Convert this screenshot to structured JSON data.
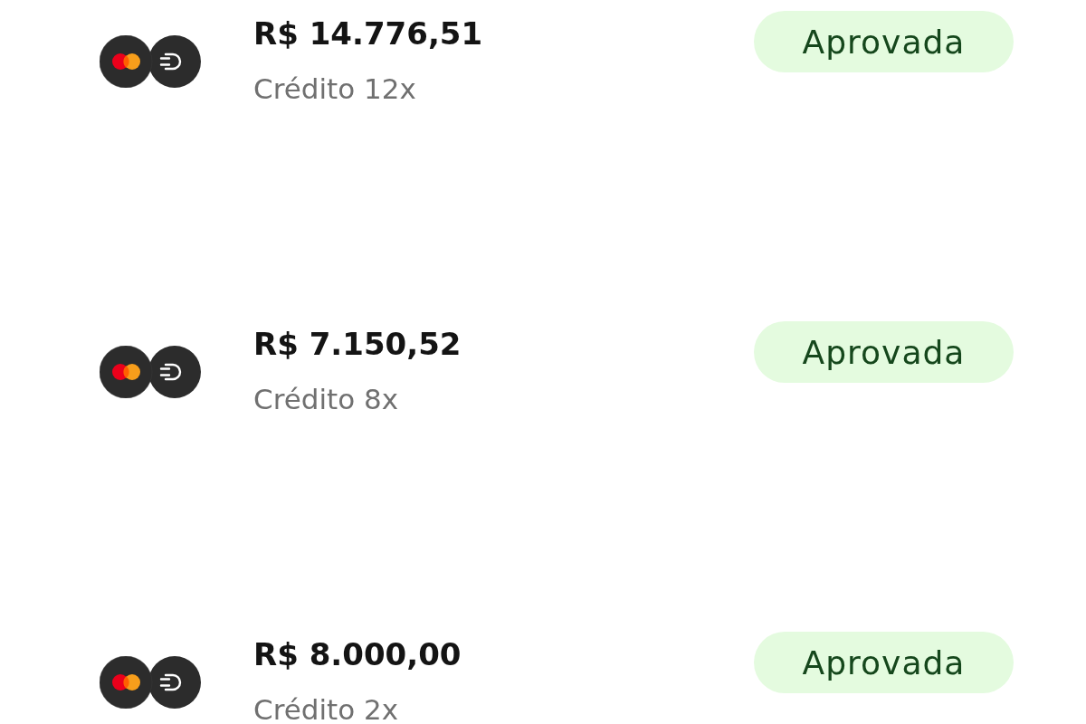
{
  "transactions": [
    {
      "amount": "R$ 14.776,51",
      "method": "Crédito 12x",
      "status": "Aprovada"
    },
    {
      "amount": "R$ 7.150,52",
      "method": "Crédito 8x",
      "status": "Aprovada"
    },
    {
      "amount": "R$ 8.000,00",
      "method": "Crédito 2x",
      "status": "Aprovada"
    }
  ]
}
